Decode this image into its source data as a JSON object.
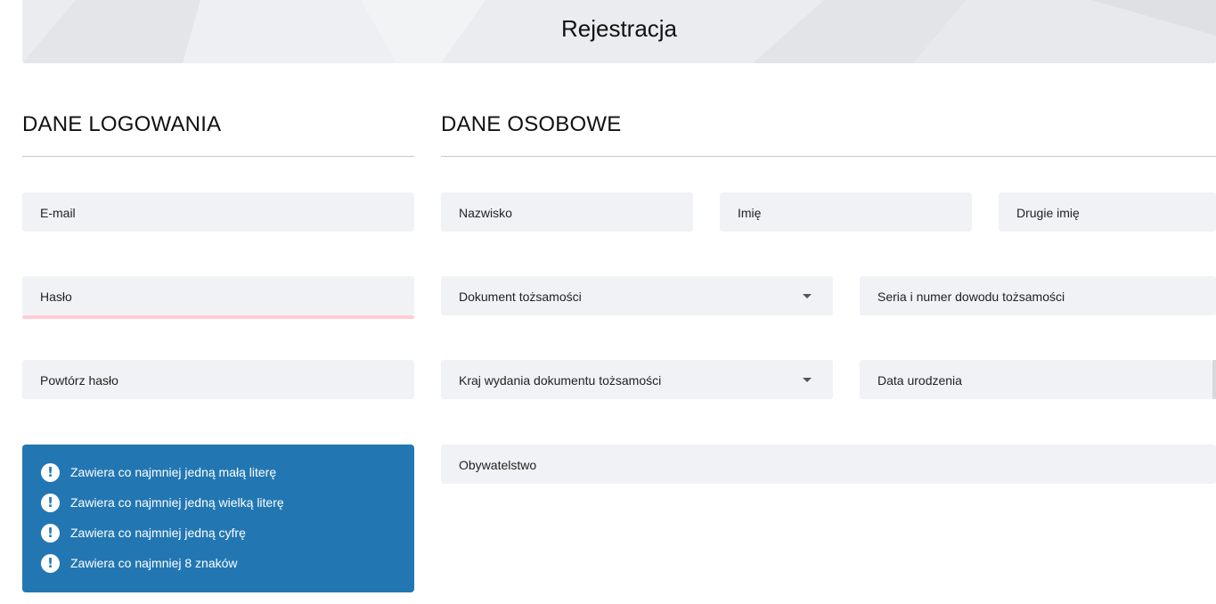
{
  "header": {
    "title": "Rejestracja"
  },
  "login_section": {
    "title": "DANE LOGOWANIA",
    "email_placeholder": "E-mail",
    "password_placeholder": "Hasło",
    "repeat_password_placeholder": "Powtórz hasło"
  },
  "personal_section": {
    "title": "DANE OSOBOWE",
    "surname_placeholder": "Nazwisko",
    "first_name_placeholder": "Imię",
    "second_name_placeholder": "Drugie imię",
    "id_document_label": "Dokument tożsamości",
    "id_series_placeholder": "Seria i numer dowodu tożsamości",
    "issuing_country_label": "Kraj wydania dokumentu tożsamości",
    "birth_date_placeholder": "Data urodzenia",
    "citizenship_placeholder": "Obywatelstwo"
  },
  "password_rules": [
    "Zawiera co najmniej jedną małą literę",
    "Zawiera co najmniej jedną wielką literę",
    "Zawiera co najmniej jedną cyfrę",
    "Zawiera co najmniej 8 znaków"
  ],
  "icons": {
    "rule_icon": "exclamation-circle-icon",
    "dropdown_icon": "caret-down-icon"
  },
  "colors": {
    "accent": "#2277b2",
    "field_background": "#f1f2f5",
    "header_background": "#ebecef",
    "error_underline": "#ffcdd3"
  }
}
